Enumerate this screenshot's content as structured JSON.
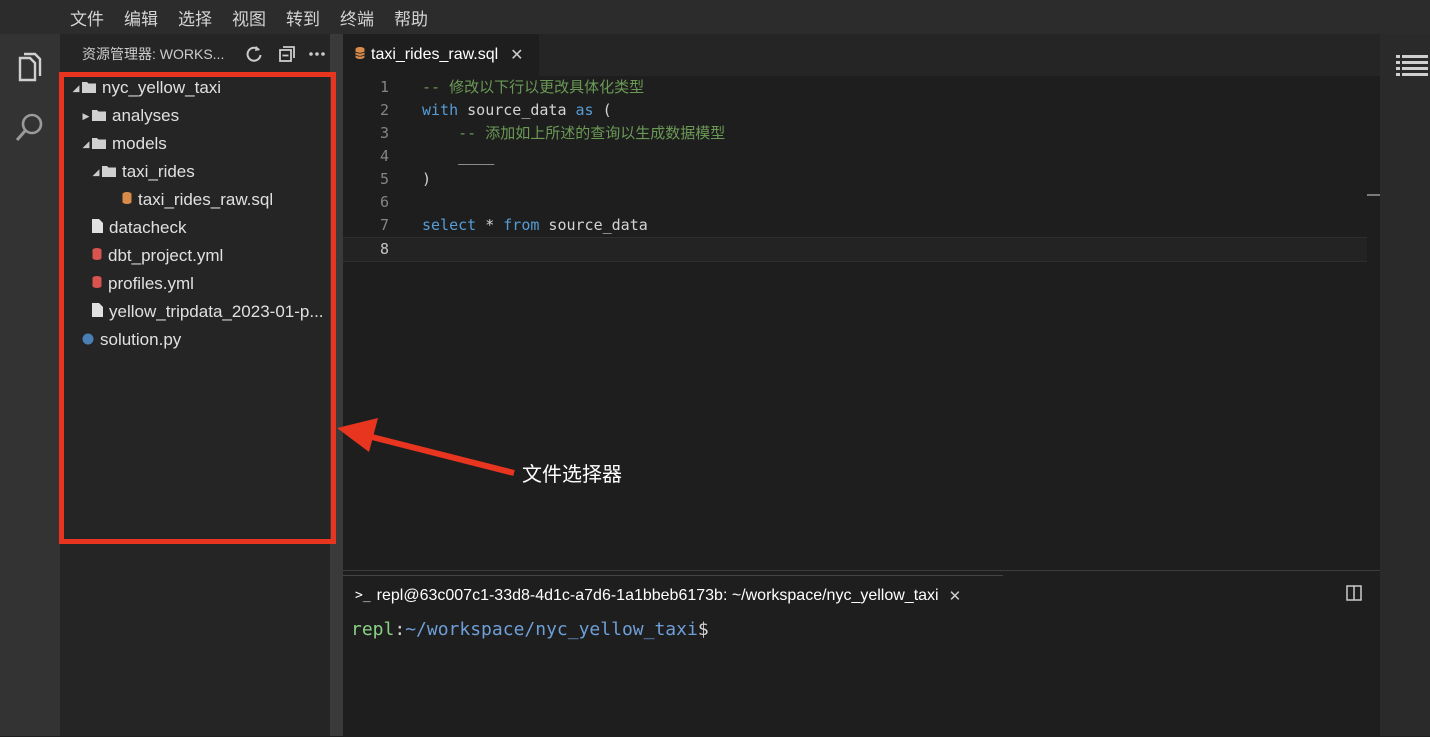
{
  "menu": [
    "文件",
    "编辑",
    "选择",
    "视图",
    "转到",
    "终端",
    "帮助"
  ],
  "activity_bar": {
    "icons": [
      "files-icon",
      "search-icon"
    ]
  },
  "sidebar": {
    "title": "资源管理器: WORKS...",
    "tree": [
      {
        "label": "nyc_yellow_taxi",
        "type": "folder",
        "expanded": true,
        "depth": 0
      },
      {
        "label": "analyses",
        "type": "folder",
        "expanded": false,
        "depth": 1
      },
      {
        "label": "models",
        "type": "folder",
        "expanded": true,
        "depth": 1
      },
      {
        "label": "taxi_rides",
        "type": "folder",
        "expanded": true,
        "depth": 2
      },
      {
        "label": "taxi_rides_raw.sql",
        "type": "sql",
        "depth": 3
      },
      {
        "label": "datacheck",
        "type": "file",
        "depth": 1
      },
      {
        "label": "dbt_project.yml",
        "type": "yml",
        "depth": 1
      },
      {
        "label": "profiles.yml",
        "type": "yml",
        "depth": 1
      },
      {
        "label": "yellow_tripdata_2023-01-p...",
        "type": "file",
        "depth": 1
      },
      {
        "label": "solution.py",
        "type": "py",
        "depth": 0
      }
    ]
  },
  "editor": {
    "tab_label": "taxi_rides_raw.sql",
    "active_line": 8,
    "lines": [
      {
        "n": "1",
        "tokens": [
          {
            "t": "-- 修改以下行以更改具体化类型",
            "c": "cm"
          }
        ]
      },
      {
        "n": "2",
        "tokens": [
          {
            "t": "with",
            "c": "kw"
          },
          {
            "t": " source_data ",
            "c": "tx"
          },
          {
            "t": "as",
            "c": "kw"
          },
          {
            "t": " (",
            "c": "tx"
          }
        ]
      },
      {
        "n": "3",
        "tokens": [
          {
            "t": "    -- 添加如上所述的查询以生成数据模型",
            "c": "cm"
          }
        ]
      },
      {
        "n": "4",
        "tokens": [
          {
            "t": "    ____",
            "c": "tx"
          }
        ]
      },
      {
        "n": "5",
        "tokens": [
          {
            "t": ")",
            "c": "tx"
          }
        ]
      },
      {
        "n": "6",
        "tokens": []
      },
      {
        "n": "7",
        "tokens": [
          {
            "t": "select",
            "c": "kw"
          },
          {
            "t": " * ",
            "c": "tx"
          },
          {
            "t": "from",
            "c": "kw"
          },
          {
            "t": " source_data",
            "c": "tx"
          }
        ]
      },
      {
        "n": "8",
        "tokens": []
      }
    ]
  },
  "terminal": {
    "tab_label": "repl@63c007c1-33d8-4d1c-a7d6-1a1bbeb6173b: ~/workspace/nyc_yellow_taxi",
    "prompt_user": "repl",
    "prompt_sep": ":",
    "prompt_path": "~/workspace/nyc_yellow_taxi",
    "prompt_end": "$"
  },
  "annotation": {
    "label": "文件选择器",
    "color": "#e8351f"
  },
  "colors": {
    "comment": "#6a9955",
    "keyword": "#569cd6",
    "sql_icon": "#d98b4a",
    "yml_icon": "#d9534f",
    "py_icon": "#4a7fb5"
  }
}
